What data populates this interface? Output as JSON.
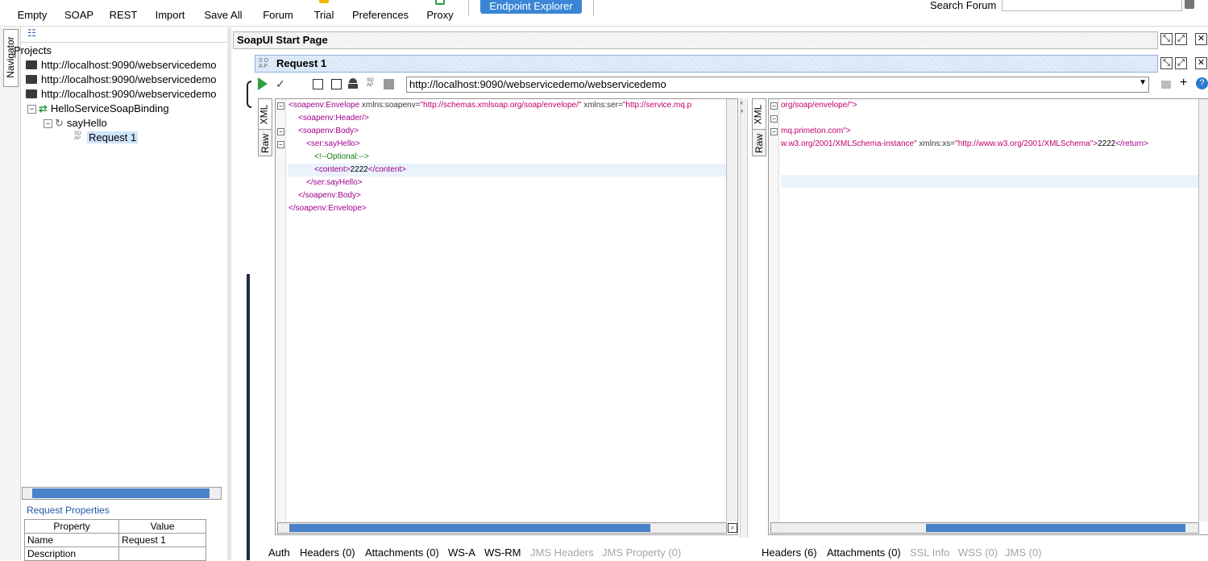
{
  "toolbar": {
    "items": [
      "Empty",
      "SOAP",
      "REST",
      "Import",
      "Save All",
      "Forum",
      "Trial",
      "Preferences",
      "Proxy"
    ],
    "endpoint_explorer": "Endpoint Explorer",
    "search_label": "Search Forum",
    "search_value": ""
  },
  "navigator": {
    "tab_label": "Navigator",
    "tree": {
      "root": "Projects",
      "projects": [
        "http://localhost:9090/webservicedemo",
        "http://localhost:9090/webservicedemo",
        "http://localhost:9090/webservicedemo"
      ],
      "binding": "HelloServiceSoapBinding",
      "operation": "sayHello",
      "request": "Request 1"
    },
    "properties": {
      "title": "Request Properties",
      "headers": [
        "Property",
        "Value"
      ],
      "rows": [
        {
          "property": "Name",
          "value": "Request 1"
        },
        {
          "property": "Description",
          "value": ""
        }
      ]
    }
  },
  "start_page": {
    "title": "SoapUI Start Page"
  },
  "request": {
    "title": "Request 1",
    "endpoint": "http://localhost:9090/webservicedemo/webservicedemo",
    "left_side_tabs": [
      "XML",
      "Raw"
    ],
    "right_side_tabs": [
      "XML",
      "Raw"
    ],
    "request_xml": [
      {
        "open": "<soapenv:Envelope",
        "attrs": " xmlns:soapenv=",
        "str": "\"http://schemas.xmlsoap.org/soap/envelope/\"",
        "attrs2": " xmlns:ser=",
        "str2": "\"http://service.mq.p"
      },
      {
        "tag": "<soapenv:Header/>"
      },
      {
        "tag": "<soapenv:Body>"
      },
      {
        "tag": "<ser:sayHello>"
      },
      {
        "comment": "<!--Optional:-->"
      },
      {
        "tag": "<content>",
        "text": "2222",
        "close": "</content>"
      },
      {
        "tag": "</ser:sayHello>"
      },
      {
        "tag": "</soapenv:Body>"
      },
      {
        "tag": "</soapenv:Envelope>"
      }
    ],
    "response_xml": [
      {
        "str": "org/soap/envelope/\"",
        "tag": ">"
      },
      {
        "str": "mq.primeton.com\"",
        "tag": ">"
      },
      {
        "str": "w.w3.org/2001/XMLSchema-instance\"",
        "attrs": " xmlns:xs=",
        "str2": "\"http://www.w3.org/2001/XMLSchema\"",
        "tag": ">",
        "text": "2222",
        "close": "</return>"
      }
    ],
    "request_tabs": [
      "Auth",
      "Headers (0)",
      "Attachments (0)",
      "WS-A",
      "WS-RM",
      "JMS Headers",
      "JMS Property (0)"
    ],
    "response_tabs": [
      "Headers (6)",
      "Attachments (0)",
      "SSL Info",
      "WSS (0)",
      "JMS (0)"
    ]
  }
}
